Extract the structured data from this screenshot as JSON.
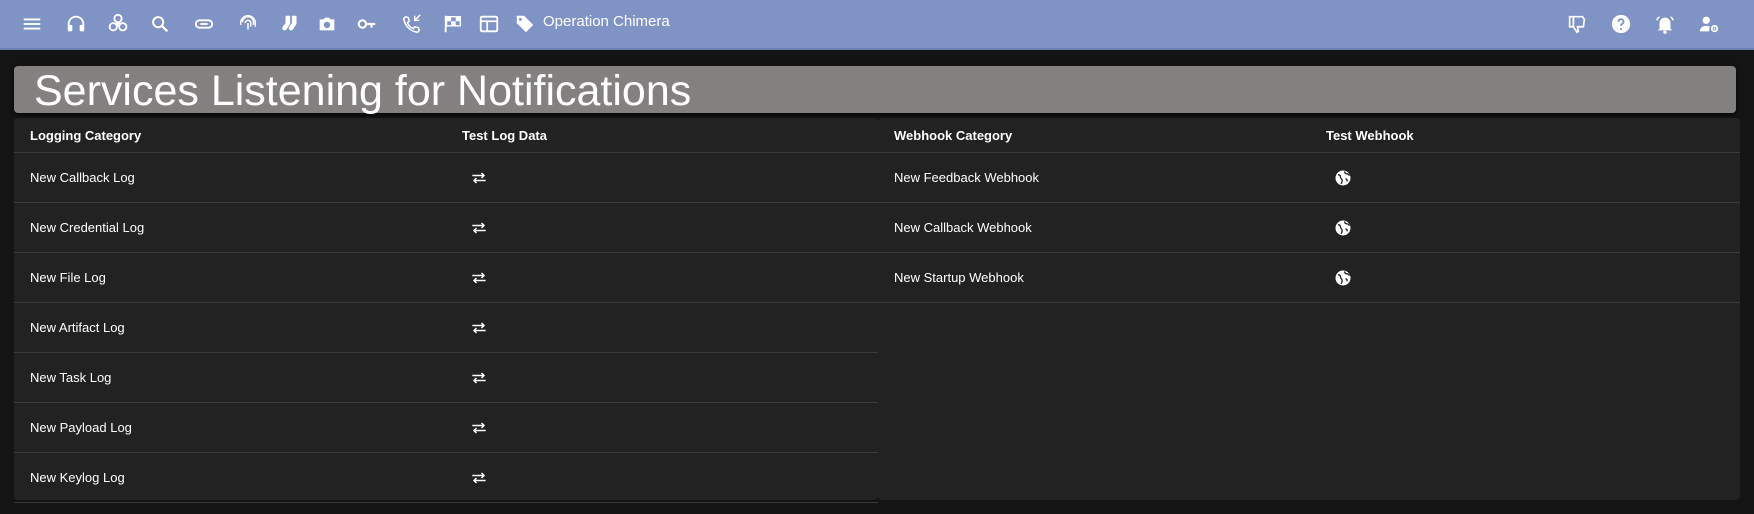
{
  "topbar": {
    "menu_icon": "hamburger-menu-icon",
    "operation_name": "Operation Chimera",
    "left_icons": [
      "headphones-icon",
      "biohazard-icon",
      "search-icon",
      "paperclip-icon",
      "fingerprint-icon",
      "socks-icon",
      "camera-icon",
      "key-icon",
      "phone-callback-icon",
      "checkered-flag-icon",
      "table-icon",
      "tag-icon"
    ],
    "right_icons": [
      "thumbs-down-icon",
      "help-icon",
      "alarm-bell-icon",
      "user-settings-icon"
    ]
  },
  "page": {
    "title": "Services Listening for Notifications"
  },
  "logging_table": {
    "headers": {
      "category": "Logging Category",
      "action": "Test Log Data"
    },
    "rows": [
      {
        "label": "New Callback Log",
        "action_icon": "swap-arrows-icon"
      },
      {
        "label": "New Credential Log",
        "action_icon": "swap-arrows-icon"
      },
      {
        "label": "New File Log",
        "action_icon": "swap-arrows-icon"
      },
      {
        "label": "New Artifact Log",
        "action_icon": "swap-arrows-icon"
      },
      {
        "label": "New Task Log",
        "action_icon": "swap-arrows-icon"
      },
      {
        "label": "New Payload Log",
        "action_icon": "swap-arrows-icon"
      },
      {
        "label": "New Keylog Log",
        "action_icon": "swap-arrows-icon"
      }
    ]
  },
  "webhook_table": {
    "headers": {
      "category": "Webhook Category",
      "action": "Test Webhook"
    },
    "rows": [
      {
        "label": "New Feedback Webhook",
        "action_icon": "globe-icon"
      },
      {
        "label": "New Callback Webhook",
        "action_icon": "globe-icon"
      },
      {
        "label": "New Startup Webhook",
        "action_icon": "globe-icon"
      }
    ]
  },
  "colors": {
    "topbar": "#7f93c4",
    "title_bar": "#858080",
    "panel": "#222222",
    "background": "#141414"
  }
}
